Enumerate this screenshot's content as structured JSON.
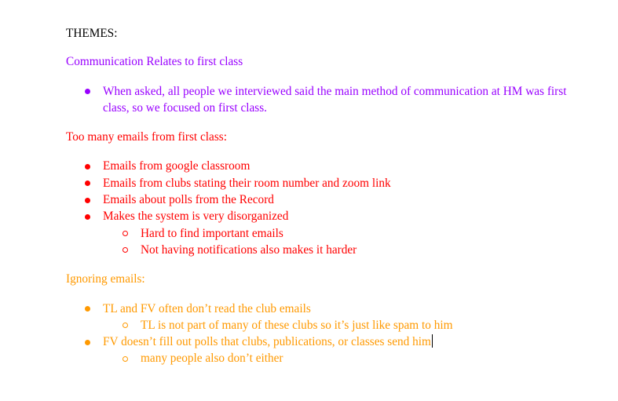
{
  "document": {
    "title": "THEMES:",
    "sections": [
      {
        "heading": "Communication Relates to first class",
        "color": "#9900ff",
        "bullets": [
          {
            "text": "When asked, all people we interviewed said the main method of communication at HM was first class, so we focused on first class.",
            "sub_bullets": []
          }
        ]
      },
      {
        "heading": "Too many emails from first class:",
        "color": "#ff0000",
        "bullets": [
          {
            "text": "Emails from google classroom",
            "sub_bullets": []
          },
          {
            "text": "Emails from clubs stating their room number and zoom link",
            "sub_bullets": []
          },
          {
            "text": "Emails about polls from the Record",
            "sub_bullets": []
          },
          {
            "text": "Makes the system is very disorganized",
            "sub_bullets": [
              "Hard to find important emails",
              "Not having notifications also makes it harder"
            ]
          }
        ]
      },
      {
        "heading": "Ignoring emails:",
        "color": "#ff9900",
        "bullets": [
          {
            "text": "TL and FV often don’t read the club emails",
            "sub_bullets": [
              "TL is not part of many of these clubs so it’s just like spam to him"
            ]
          },
          {
            "text": "FV doesn’t fill out polls that clubs, publications, or classes send him",
            "sub_bullets": [
              "many people also don’t either"
            ]
          }
        ]
      }
    ]
  }
}
